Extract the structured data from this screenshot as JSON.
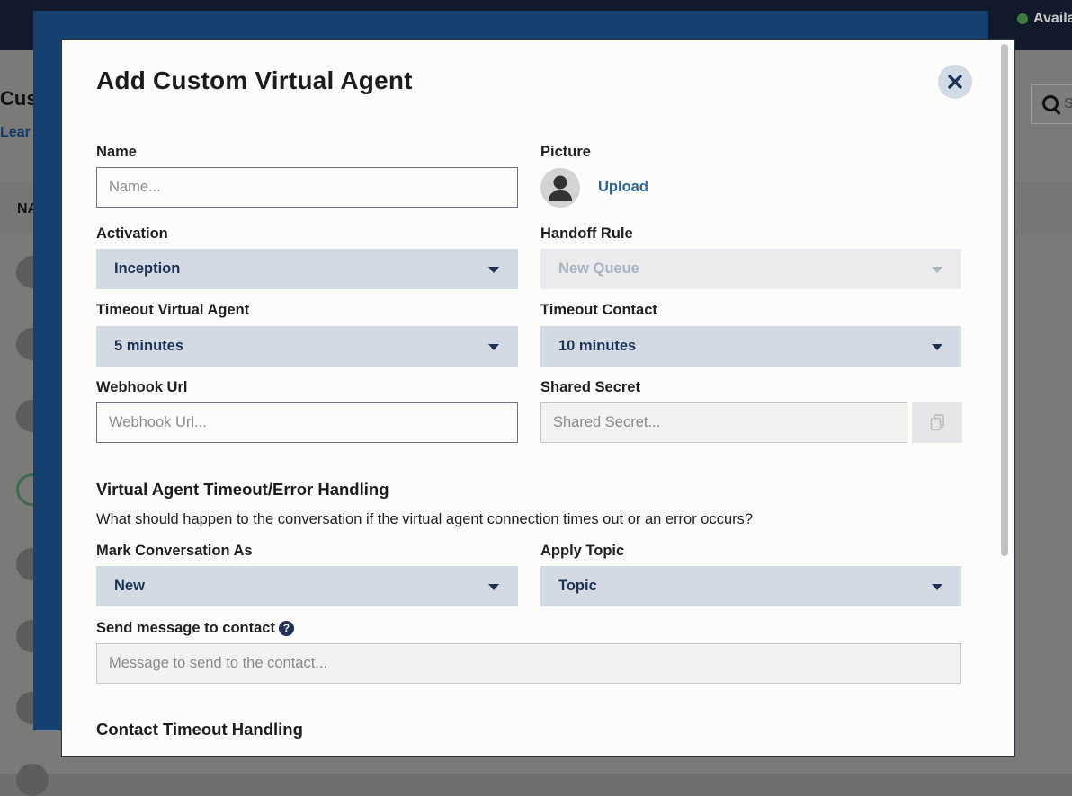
{
  "background": {
    "status": "Availa",
    "page_title": "Cus",
    "page_link": "Lear",
    "search_placeholder": "S",
    "column_header": "NA"
  },
  "modal": {
    "title": "Add Custom Virtual Agent",
    "name": {
      "label": "Name",
      "placeholder": "Name..."
    },
    "picture": {
      "label": "Picture",
      "upload": "Upload",
      "icon": "user-silhouette"
    },
    "activation": {
      "label": "Activation",
      "value": "Inception"
    },
    "handoff_rule": {
      "label": "Handoff Rule",
      "value": "New Queue"
    },
    "timeout_virtual_agent": {
      "label": "Timeout Virtual Agent",
      "value": "5 minutes"
    },
    "timeout_contact": {
      "label": "Timeout Contact",
      "value": "10 minutes"
    },
    "webhook_url": {
      "label": "Webhook Url",
      "placeholder": "Webhook Url..."
    },
    "shared_secret": {
      "label": "Shared Secret",
      "placeholder": "Shared Secret..."
    },
    "error_section": {
      "title": "Virtual Agent Timeout/Error Handling",
      "description": "What should happen to the conversation if the virtual agent connection times out or an error occurs?",
      "mark_conversation": {
        "label": "Mark Conversation As",
        "value": "New"
      },
      "apply_topic": {
        "label": "Apply Topic",
        "value": "Topic"
      },
      "send_message": {
        "label": "Send message to contact",
        "placeholder": "Message to send to the contact..."
      }
    },
    "contact_timeout_section": {
      "title": "Contact Timeout Handling"
    }
  },
  "colors": {
    "select_bg": "#d3dae4",
    "select_text": "#1e3255",
    "link": "#2c6497",
    "backdrop_blue": "#16406f"
  }
}
